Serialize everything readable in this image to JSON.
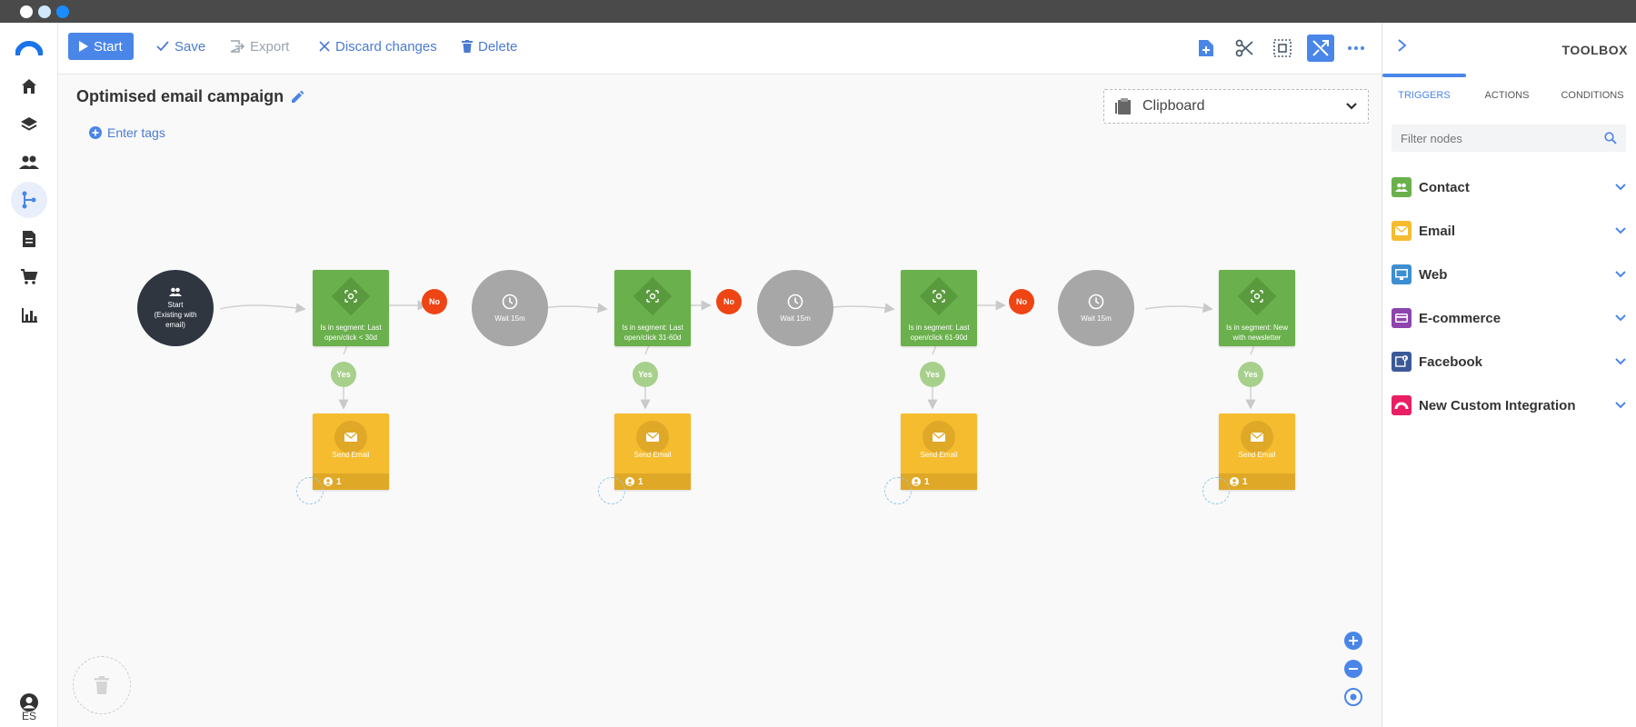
{
  "window": {
    "dots": [
      "#ffffff",
      "#cfe8fb",
      "#1a8cff"
    ]
  },
  "leftnav": {
    "items": [
      {
        "name": "brand-logo-icon"
      },
      {
        "name": "home-icon"
      },
      {
        "name": "layers-icon"
      },
      {
        "name": "contacts-icon"
      },
      {
        "name": "workflow-icon",
        "active": true
      },
      {
        "name": "document-icon"
      },
      {
        "name": "cart-icon"
      },
      {
        "name": "chart-icon"
      }
    ],
    "profile": {
      "icon": "user-circle-icon",
      "lang": "ES"
    }
  },
  "toolbar": {
    "start_label": "Start",
    "save_label": "Save",
    "export_label": "Export",
    "discard_label": "Discard changes",
    "delete_label": "Delete",
    "icons": [
      "add-node-icon",
      "scissors-icon",
      "select-icon",
      "shuffle-icon",
      "more-icon"
    ]
  },
  "canvas": {
    "title": "Optimised email campaign",
    "tags_label": "Enter tags",
    "clipboard_label": "Clipboard",
    "start_node": {
      "line1": "Start",
      "line2": "(Existing with",
      "line3": "email)"
    },
    "conditions": [
      {
        "line1": "Is in segment: Last",
        "line2": "open/click < 30d"
      },
      {
        "line1": "Is in segment: Last",
        "line2": "open/click 31-60d"
      },
      {
        "line1": "Is in segment: Last",
        "line2": "open/click 61-90d"
      },
      {
        "line1": "Is in segment: New",
        "line2": "with newsletter"
      }
    ],
    "waits": [
      "Wait 15m",
      "Wait 15m",
      "Wait 15m"
    ],
    "no_label": "No",
    "yes_label": "Yes",
    "email_node_label": "Send Email",
    "email_count": "1"
  },
  "toolbox": {
    "title": "TOOLBOX",
    "tabs": [
      "TRIGGERS",
      "ACTIONS",
      "CONDITIONS"
    ],
    "filter_placeholder": "Filter nodes",
    "categories": [
      {
        "label": "Contact",
        "color": "#6ab04c"
      },
      {
        "label": "Email",
        "color": "#f5bc2f"
      },
      {
        "label": "Web",
        "color": "#3d8fd1"
      },
      {
        "label": "E-commerce",
        "color": "#8e44ad"
      },
      {
        "label": "Facebook",
        "color": "#3b5998"
      },
      {
        "label": "New Custom Integration",
        "color": "#e91e63"
      }
    ]
  },
  "colors": {
    "accent": "#4a86e8",
    "condition": "#6ab04c",
    "action": "#f5bc2f",
    "no_badge": "#ef4414",
    "yes_badge": "#a8d08d"
  }
}
